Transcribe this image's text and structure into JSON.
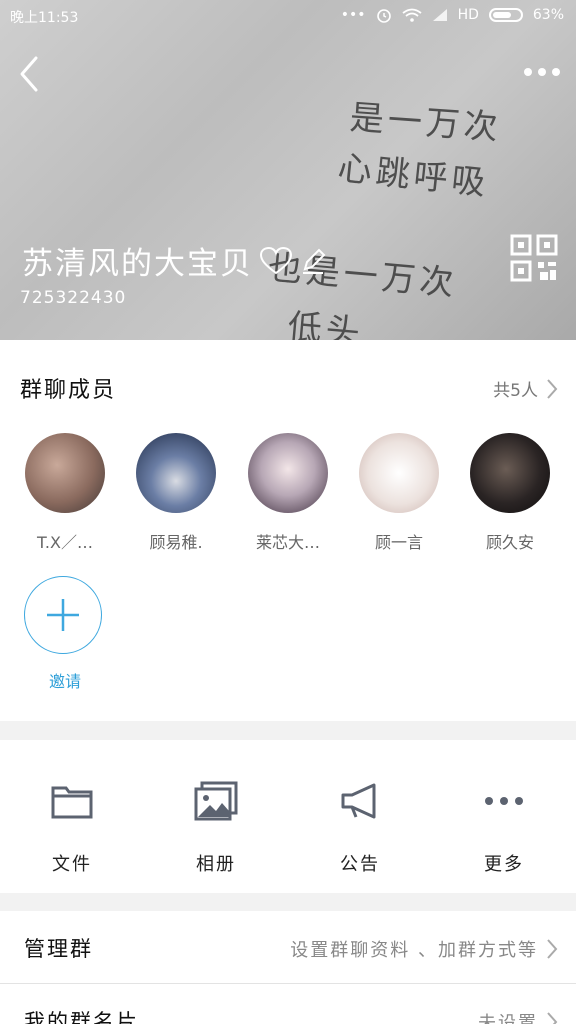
{
  "status_bar": {
    "time": "晚上11:53",
    "network": "HD",
    "battery": "63%"
  },
  "header": {
    "background_text": [
      "是一万次",
      "心跳呼吸",
      "也是一万次",
      "低头"
    ],
    "group_name": "苏清风的大宝贝",
    "group_id": "725322430",
    "icons": [
      "back-icon",
      "more-icon",
      "heart-icon",
      "edit-icon",
      "qr-code-icon"
    ]
  },
  "members": {
    "title": "群聊成员",
    "count_label": "共5人",
    "list": [
      {
        "name": "T.X／…",
        "avatar_color": "#8a6a5e"
      },
      {
        "name": "顾易稚.",
        "avatar_color": "#2c3f63"
      },
      {
        "name": "莱芯大…",
        "avatar_color": "#b7a7b5"
      },
      {
        "name": "顾一言",
        "avatar_color": "#e8ddd8"
      },
      {
        "name": "顾久安",
        "avatar_color": "#2a2424"
      }
    ],
    "invite_label": "邀请",
    "accent_color": "#2e9fd8"
  },
  "tools": [
    {
      "label": "文件",
      "icon": "folder-icon"
    },
    {
      "label": "相册",
      "icon": "album-icon"
    },
    {
      "label": "公告",
      "icon": "announcement-icon"
    },
    {
      "label": "更多",
      "icon": "more-dots-icon"
    }
  ],
  "rows": {
    "manage": {
      "title": "管理群",
      "value": "设置群聊资料 、加群方式等"
    },
    "my_card": {
      "title": "我的群名片",
      "value": "未设置"
    }
  }
}
